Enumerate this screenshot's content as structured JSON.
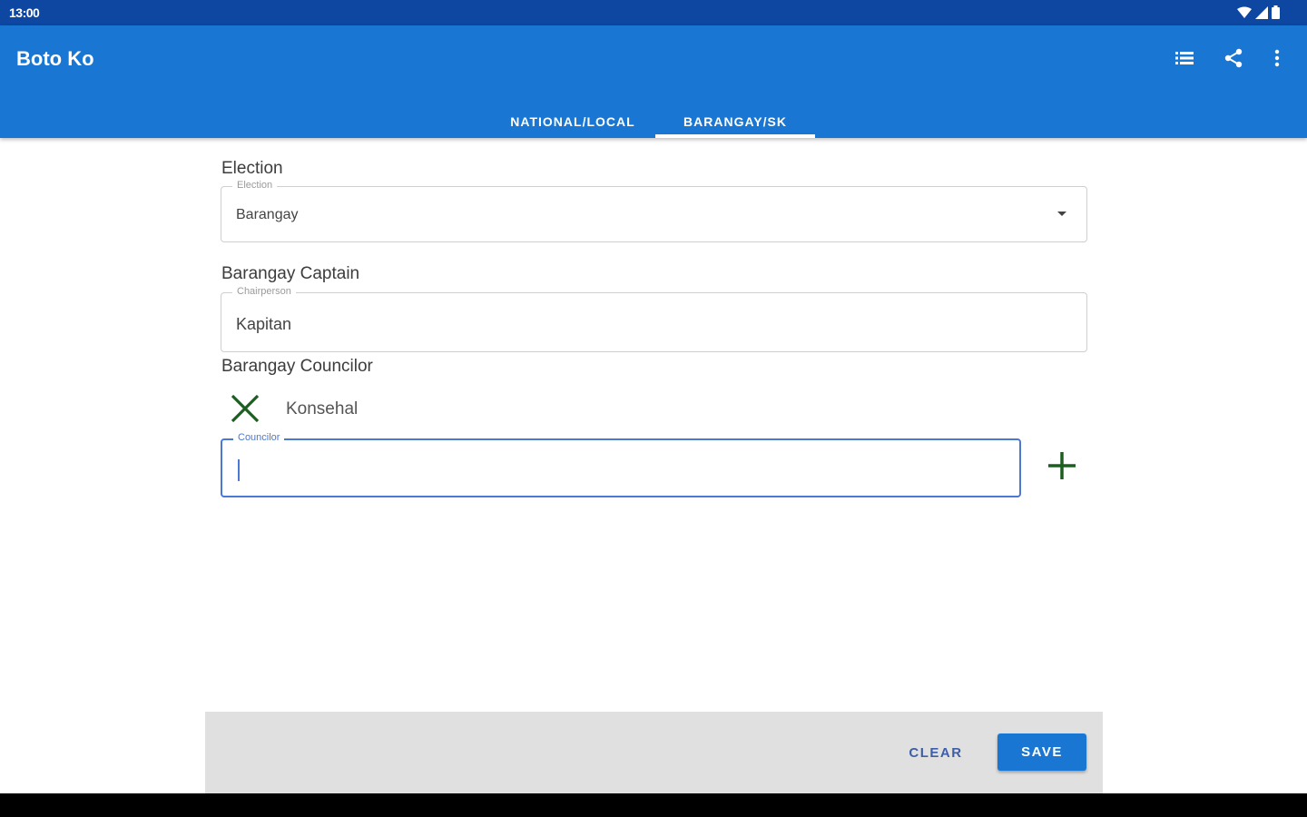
{
  "status_bar": {
    "time": "13:00",
    "icons": [
      "wifi-icon",
      "cell-signal-icon",
      "battery-icon"
    ]
  },
  "app_bar": {
    "title": "Boto Ko",
    "actions": [
      "list-icon",
      "share-icon",
      "more-vert-icon"
    ]
  },
  "tabs": [
    {
      "label": "NATIONAL/LOCAL",
      "selected": false
    },
    {
      "label": "BARANGAY/SK",
      "selected": true
    }
  ],
  "form": {
    "election": {
      "section_label": "Election",
      "legend": "Election",
      "value": "Barangay"
    },
    "captain": {
      "section_label": "Barangay Captain",
      "legend": "Chairperson",
      "value": "Kapitan"
    },
    "councilor": {
      "section_label": "Barangay Councilor",
      "entries": [
        "Konsehal"
      ],
      "legend": "Councilor",
      "value": ""
    }
  },
  "actions": {
    "clear_label": "CLEAR",
    "save_label": "SAVE"
  },
  "colors": {
    "status_bar": "#0d47a1",
    "primary": "#1976d2",
    "focus_outline": "#4a78d4",
    "icon_green": "#1b5e20",
    "bottom_bar": "#e0e0e0"
  }
}
